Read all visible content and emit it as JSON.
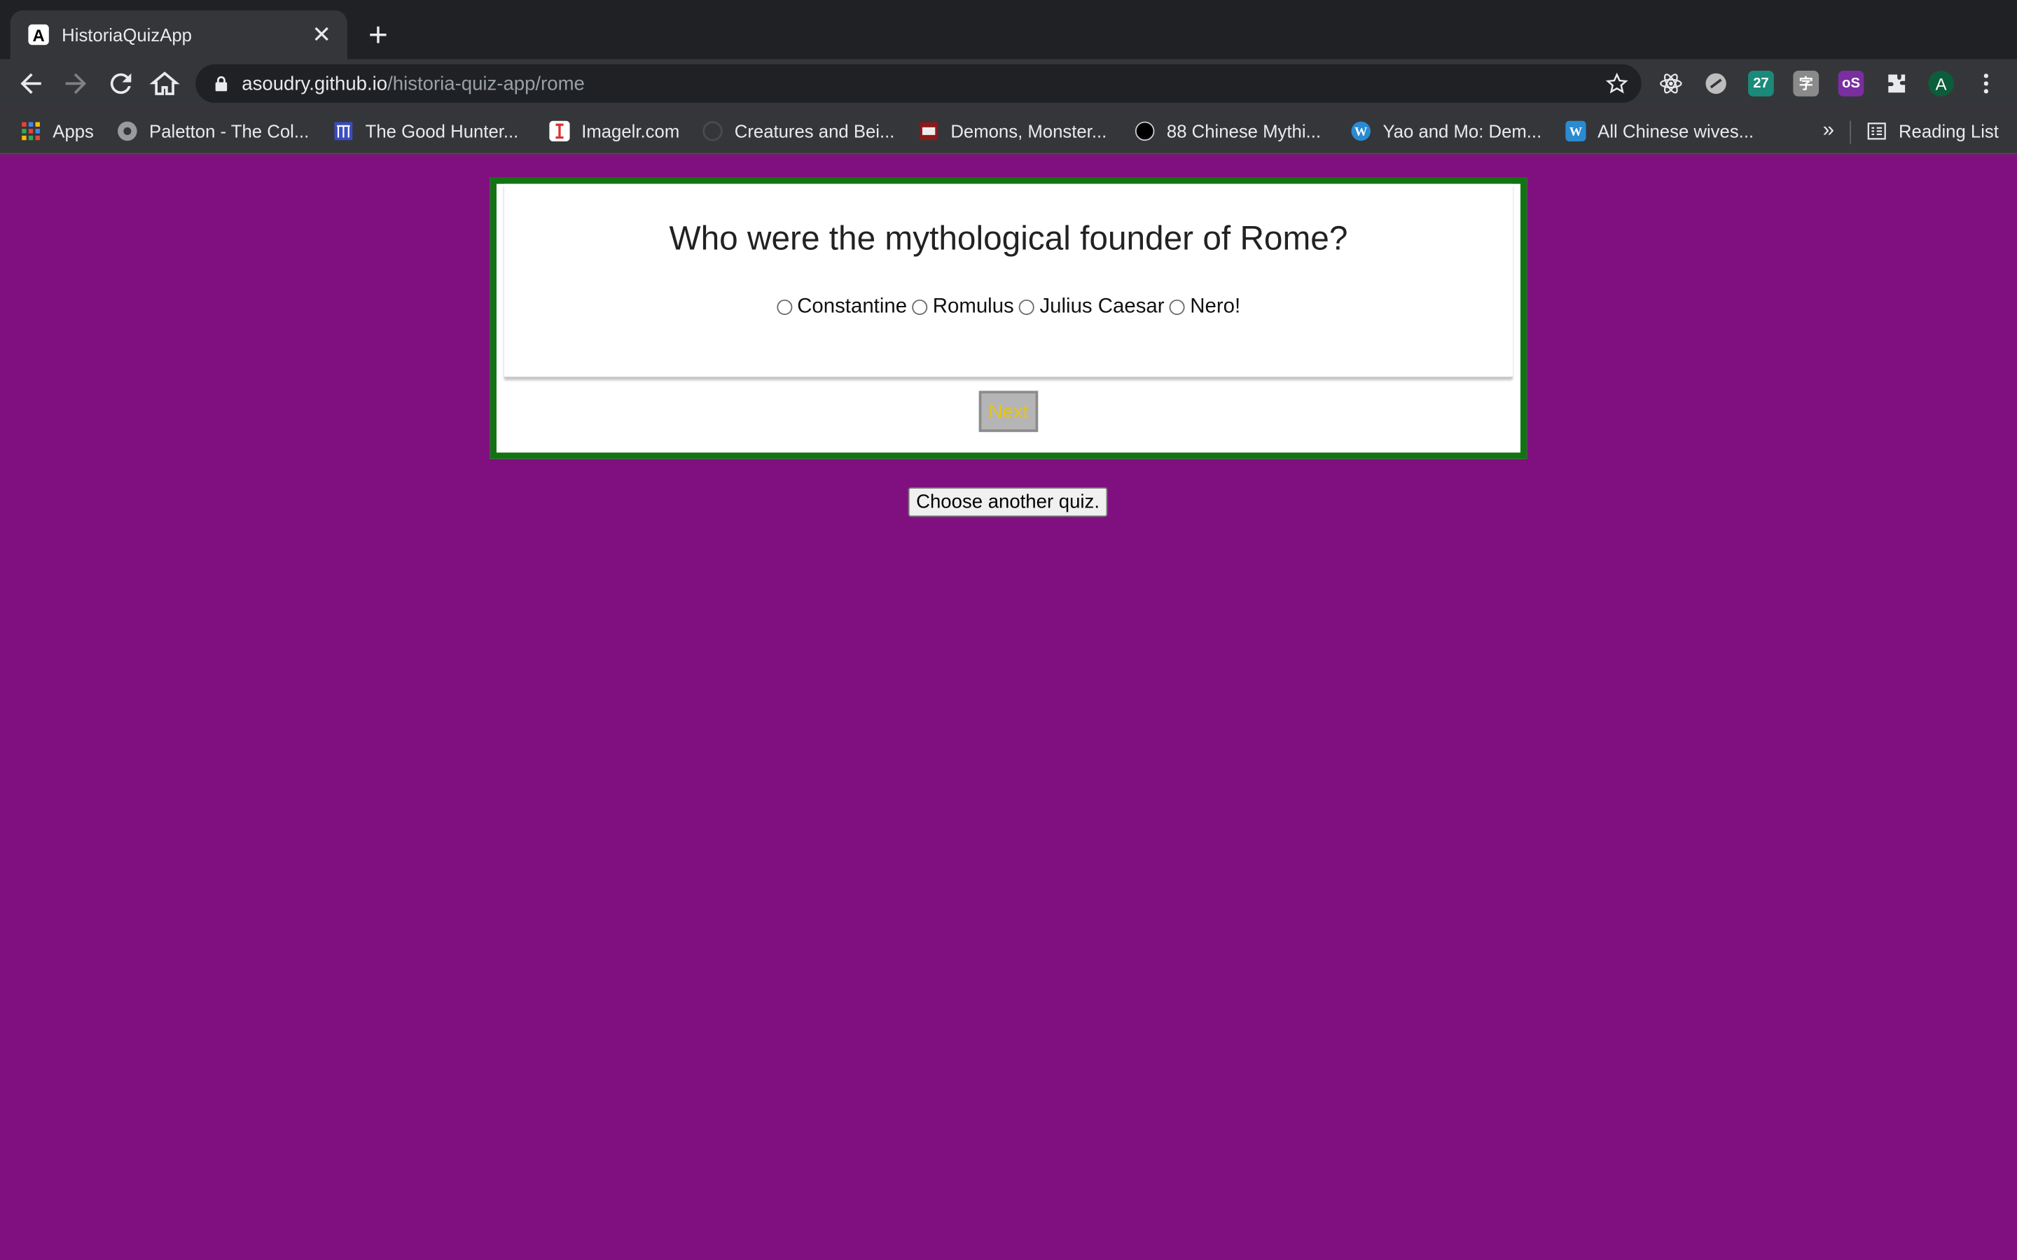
{
  "browser": {
    "tab": {
      "title": "HistoriaQuizApp",
      "favicon_letter": "A",
      "close_glyph": "✕"
    },
    "new_tab_glyph": "+",
    "url": {
      "host": "asoudry.github.io",
      "path": "/historia-quiz-app/rome"
    },
    "extensions": [
      {
        "name": "react-devtools-icon",
        "color": "#35363a",
        "label": "⚛"
      },
      {
        "name": "extension-icon",
        "color": "#5f6368",
        "label": ""
      },
      {
        "name": "calendar-extension-icon",
        "color": "#1a8a7a",
        "label": "27"
      },
      {
        "name": "kanji-extension-icon",
        "color": "#8a8a8a",
        "label": "字"
      },
      {
        "name": "os-extension-icon",
        "color": "#7a2ea0",
        "label": "oS"
      }
    ],
    "profile_initial": "A",
    "bookmarks": [
      {
        "label": "Apps",
        "icon": "apps-grid-icon"
      },
      {
        "label": "Paletton - The Col...",
        "icon": "paletton-icon"
      },
      {
        "label": "The Good Hunter...",
        "icon": "building-icon"
      },
      {
        "label": "Imagelr.com",
        "icon": "imagelr-icon"
      },
      {
        "label": "Creatures and Bei...",
        "icon": "globe-icon"
      },
      {
        "label": "Demons, Monster...",
        "icon": "book-icon"
      },
      {
        "label": "88 Chinese Mythi...",
        "icon": "circle-icon"
      },
      {
        "label": "Yao and Mo: Dem...",
        "icon": "wordpress-icon"
      },
      {
        "label": "All Chinese wives...",
        "icon": "wordpress-square-icon"
      }
    ],
    "overflow_glyph": "»",
    "reading_list": "Reading List"
  },
  "quiz": {
    "question": "Who were the mythological founder of Rome?",
    "answers": [
      "Constantine",
      "Romulus",
      "Julius Caesar",
      "Nero!"
    ],
    "next_label": "Next",
    "choose_another_label": "Choose another quiz."
  },
  "colors": {
    "page_background": "#801080",
    "card_border": "#127312",
    "next_text": "#e8c411"
  }
}
